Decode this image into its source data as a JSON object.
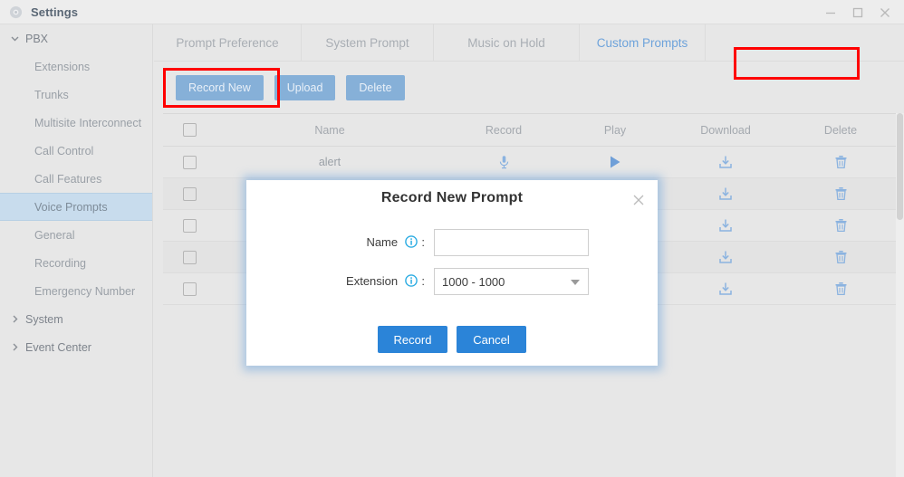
{
  "window": {
    "title": "Settings",
    "gear_icon": "gear-icon",
    "minimize_label": "–",
    "maximize_label": "□",
    "close_label": "×"
  },
  "sidebar": {
    "groups": [
      {
        "label": "PBX",
        "expanded": true,
        "caret": "chevron-down-icon",
        "items": [
          {
            "label": "Extensions",
            "active": false
          },
          {
            "label": "Trunks",
            "active": false
          },
          {
            "label": "Multisite Interconnect",
            "active": false
          },
          {
            "label": "Call Control",
            "active": false
          },
          {
            "label": "Call Features",
            "active": false
          },
          {
            "label": "Voice Prompts",
            "active": true
          },
          {
            "label": "General",
            "active": false
          },
          {
            "label": "Recording",
            "active": false
          },
          {
            "label": "Emergency Number",
            "active": false
          }
        ]
      },
      {
        "label": "System",
        "expanded": false,
        "caret": "chevron-right-icon",
        "items": []
      },
      {
        "label": "Event Center",
        "expanded": false,
        "caret": "chevron-right-icon",
        "items": []
      }
    ]
  },
  "tabs": [
    {
      "label": "Prompt Preference",
      "active": false
    },
    {
      "label": "System Prompt",
      "active": false
    },
    {
      "label": "Music on Hold",
      "active": false
    },
    {
      "label": "Custom Prompts",
      "active": true
    }
  ],
  "toolbar": {
    "record_new_label": "Record New",
    "upload_label": "Upload",
    "delete_label": "Delete"
  },
  "table": {
    "columns": [
      "",
      "Name",
      "Record",
      "Play",
      "Download",
      "Delete"
    ],
    "rows": [
      {
        "name": "alert",
        "checked": false
      },
      {
        "name": "",
        "checked": false
      },
      {
        "name": "",
        "checked": false
      },
      {
        "name": "",
        "checked": false
      },
      {
        "name": "",
        "checked": false
      }
    ],
    "row_icons": {
      "record": "microphone-icon",
      "play": "play-icon",
      "download": "download-icon",
      "delete": "trash-icon"
    }
  },
  "modal": {
    "title": "Record New Prompt",
    "close_label": "×",
    "name_label": "Name",
    "name_suffix": ":",
    "name_value": "",
    "name_placeholder": "",
    "extension_label": "Extension",
    "extension_suffix": ":",
    "extension_value": "1000 - 1000",
    "record_label": "Record",
    "cancel_label": "Cancel",
    "info_icon": "info-icon"
  },
  "colors": {
    "accent_blue": "#2b84d8",
    "toolbar_blue": "#86b0d8",
    "icon_blue": "#8bb3e0",
    "highlight_red": "#ff0000",
    "active_nav": "#c8dced",
    "panel_bg": "#e7e7e7"
  }
}
